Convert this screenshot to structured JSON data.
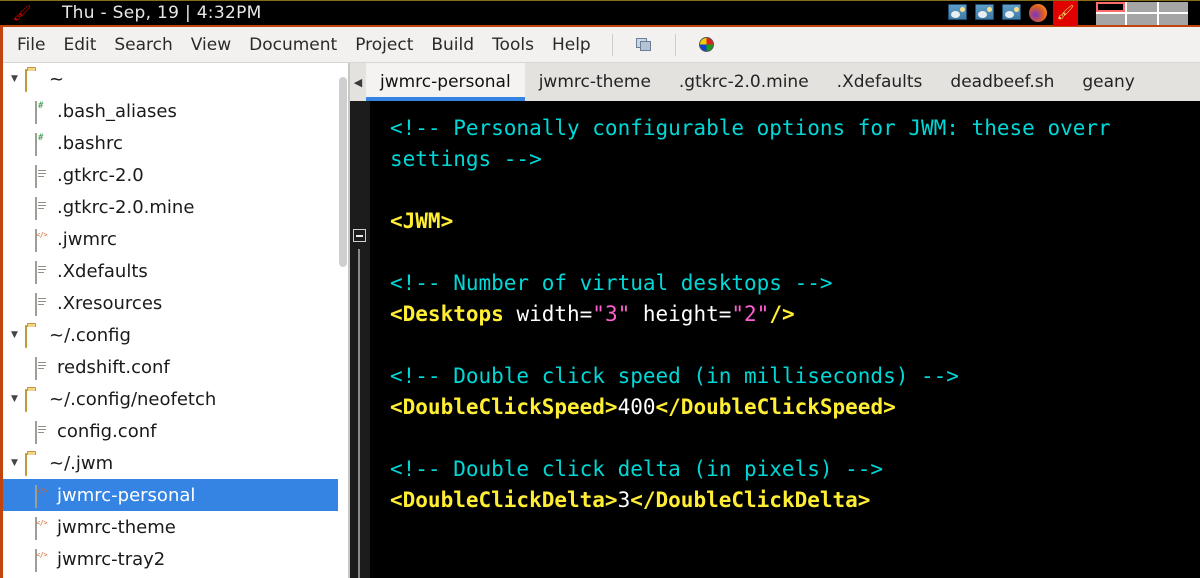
{
  "taskbar": {
    "launcher_icon": "lamp-icon",
    "clock": "Thu - Sep, 19 |  4:32PM",
    "tray_icons": [
      "image-viewer-icon",
      "image-viewer-icon",
      "image-viewer-icon",
      "firefox-icon",
      "lamp-icon"
    ],
    "pager": {
      "columns": 3,
      "rows": 2,
      "active_index": 0
    }
  },
  "menubar": {
    "items": [
      "File",
      "Edit",
      "Search",
      "View",
      "Document",
      "Project",
      "Build",
      "Tools",
      "Help"
    ],
    "toolbar_icons": [
      "windows-copy-icon",
      "color-wheel-icon"
    ]
  },
  "sidebar": {
    "rows": [
      {
        "label": "~",
        "type": "folder",
        "expanded": true,
        "depth": 0,
        "icon": "folder-icon",
        "selected": false
      },
      {
        "label": ".bash_aliases",
        "type": "script",
        "depth": 1,
        "icon": "script-file-icon",
        "selected": false
      },
      {
        "label": ".bashrc",
        "type": "script",
        "depth": 1,
        "icon": "script-file-icon",
        "selected": false
      },
      {
        "label": ".gtkrc-2.0",
        "type": "text",
        "depth": 1,
        "icon": "text-file-icon",
        "selected": false
      },
      {
        "label": ".gtkrc-2.0.mine",
        "type": "text",
        "depth": 1,
        "icon": "text-file-icon",
        "selected": false
      },
      {
        "label": ".jwmrc",
        "type": "xml",
        "depth": 1,
        "icon": "xml-file-icon",
        "selected": false
      },
      {
        "label": ".Xdefaults",
        "type": "text",
        "depth": 1,
        "icon": "text-file-icon",
        "selected": false
      },
      {
        "label": ".Xresources",
        "type": "text",
        "depth": 1,
        "icon": "text-file-icon",
        "selected": false
      },
      {
        "label": "~/.config",
        "type": "folder",
        "expanded": true,
        "depth": 0,
        "icon": "folder-icon",
        "selected": false
      },
      {
        "label": "redshift.conf",
        "type": "text",
        "depth": 1,
        "icon": "text-file-icon",
        "selected": false
      },
      {
        "label": "~/.config/neofetch",
        "type": "folder",
        "expanded": true,
        "depth": 0,
        "icon": "folder-icon",
        "selected": false
      },
      {
        "label": "config.conf",
        "type": "text",
        "depth": 1,
        "icon": "text-file-icon",
        "selected": false
      },
      {
        "label": "~/.jwm",
        "type": "folder",
        "expanded": true,
        "depth": 0,
        "icon": "folder-icon",
        "selected": false
      },
      {
        "label": "jwmrc-personal",
        "type": "xml",
        "depth": 1,
        "icon": "xml-file-icon",
        "selected": true
      },
      {
        "label": "jwmrc-theme",
        "type": "xml",
        "depth": 1,
        "icon": "xml-file-icon",
        "selected": false
      },
      {
        "label": "jwmrc-tray2",
        "type": "xml",
        "depth": 1,
        "icon": "xml-file-icon",
        "selected": false
      }
    ]
  },
  "editor": {
    "tab_scroll_left_icon": "chevron-left-icon",
    "tabs": [
      {
        "label": "jwmrc-personal",
        "active": true
      },
      {
        "label": "jwmrc-theme",
        "active": false
      },
      {
        "label": ".gtkrc-2.0.mine",
        "active": false
      },
      {
        "label": ".Xdefaults",
        "active": false
      },
      {
        "label": "deadbeef.sh",
        "active": false
      },
      {
        "label": "geany",
        "active": false
      }
    ],
    "fold_marker": "collapse-fold-icon",
    "code_lines": [
      {
        "segments": [
          {
            "t": "<!-- Personally configurable options for JWM: these overr",
            "c": "cm"
          }
        ]
      },
      {
        "segments": [
          {
            "t": "settings -->",
            "c": "cm"
          }
        ]
      },
      {
        "segments": []
      },
      {
        "segments": [
          {
            "t": "<JWM>",
            "c": "tg"
          }
        ]
      },
      {
        "segments": []
      },
      {
        "segments": [
          {
            "t": "<!-- Number of virtual desktops -->",
            "c": "cm"
          }
        ]
      },
      {
        "segments": [
          {
            "t": "<Desktops ",
            "c": "tg"
          },
          {
            "t": "width=",
            "c": "at"
          },
          {
            "t": "\"3\"",
            "c": "vl"
          },
          {
            "t": " height=",
            "c": "at"
          },
          {
            "t": "\"2\"",
            "c": "vl"
          },
          {
            "t": "/>",
            "c": "tg"
          }
        ]
      },
      {
        "segments": []
      },
      {
        "segments": [
          {
            "t": "<!-- Double click speed (in milliseconds) -->",
            "c": "cm"
          }
        ]
      },
      {
        "segments": [
          {
            "t": "<DoubleClickSpeed>",
            "c": "tg"
          },
          {
            "t": "400",
            "c": "tx"
          },
          {
            "t": "</DoubleClickSpeed>",
            "c": "tg"
          }
        ]
      },
      {
        "segments": []
      },
      {
        "segments": [
          {
            "t": "<!-- Double click delta (in pixels) -->",
            "c": "cm"
          }
        ]
      },
      {
        "segments": [
          {
            "t": "<DoubleClickDelta>",
            "c": "tg"
          },
          {
            "t": "3",
            "c": "tx"
          },
          {
            "t": "</DoubleClickDelta>",
            "c": "tg"
          }
        ]
      }
    ]
  },
  "colors": {
    "accent_blue": "#3584e4",
    "window_border_red": "#c1440e",
    "comment_cyan": "#00d8d8",
    "tag_yellow": "#ffee33",
    "value_magenta": "#ff5fd2",
    "editor_bg": "#000000"
  }
}
